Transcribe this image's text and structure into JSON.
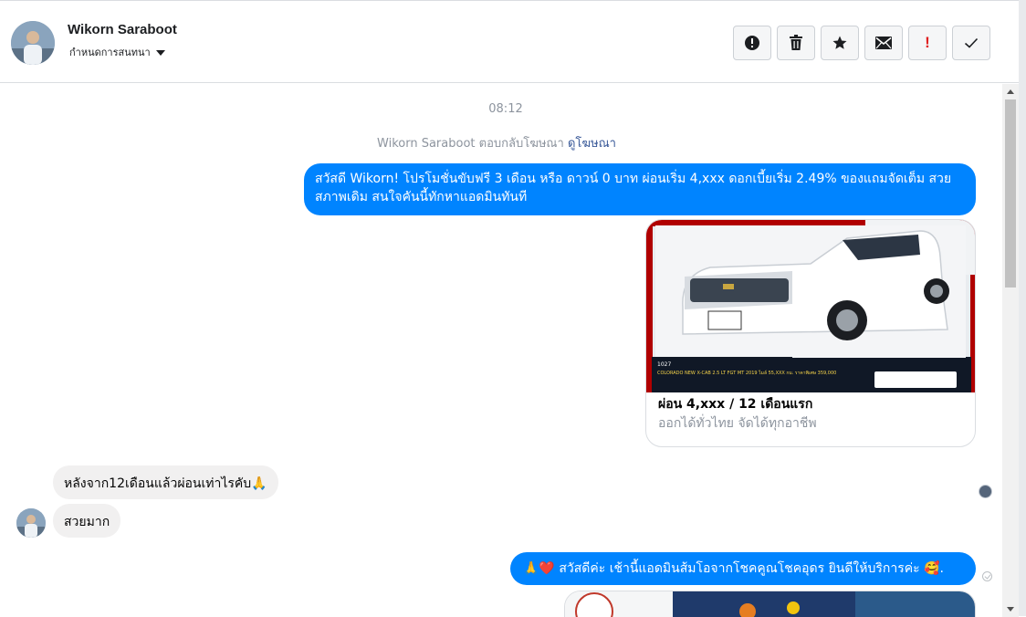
{
  "header": {
    "contact_name": "Wikorn Saraboot",
    "conversation_setting": "กำหนดการสนทนา",
    "toolbar": [
      {
        "name": "report-button",
        "icon": "alert-circle-icon"
      },
      {
        "name": "delete-button",
        "icon": "trash-icon"
      },
      {
        "name": "star-button",
        "icon": "star-icon"
      },
      {
        "name": "mark-unread-button",
        "icon": "envelope-icon"
      },
      {
        "name": "important-button",
        "icon": "exclamation-icon",
        "label": "!"
      },
      {
        "name": "mark-done-button",
        "icon": "check-icon"
      }
    ]
  },
  "thread": {
    "timestamp": "08:12",
    "ad_reply_note": {
      "text": "Wikorn Saraboot ตอบกลับโฆษณา",
      "link": "ดูโฆษณา"
    },
    "messages": [
      {
        "direction": "outgoing",
        "text": "สวัสดี Wikorn! โปรโมชั่นขับฟรี 3 เดือน หรือ ดาวน์ 0 บาท ผ่อนเริ่ม 4,xxx ดอกเบี้ยเริ่ม 2.49% ของแถมจัดเต็ม สวยสภาพเดิม สนใจคันนี้ทักหาแอดมินทันที"
      },
      {
        "direction": "outgoing",
        "type": "card",
        "title": "ผ่อน 4,xxx / 12 เดือนแรก",
        "subtitle": "ออกได้ทั่วไทย จัดได้ทุกอาชีพ",
        "image_caption": "COLORADO NEW X-CAB 2.5 LT FGT MT 2019 ไมล์ 55,XXX กม. ราคาพิเศษ 359,000",
        "image_code": "1027"
      },
      {
        "direction": "incoming",
        "text": "หลังจาก12เดือนแล้วผ่อนเท่าไรคับ🙏"
      },
      {
        "direction": "incoming",
        "text": "สวยมาก"
      },
      {
        "direction": "outgoing",
        "text": "🙏❤️ สวัสดีค่ะ เช้านี้แอดมินส้มโอจากโชคคูณโชคอุดร ยินดีให้บริการค่ะ 🥰."
      }
    ]
  },
  "colors": {
    "outgoing_bubble": "#0084ff",
    "incoming_bubble": "#f1f0f0",
    "important_red": "#e02020"
  }
}
